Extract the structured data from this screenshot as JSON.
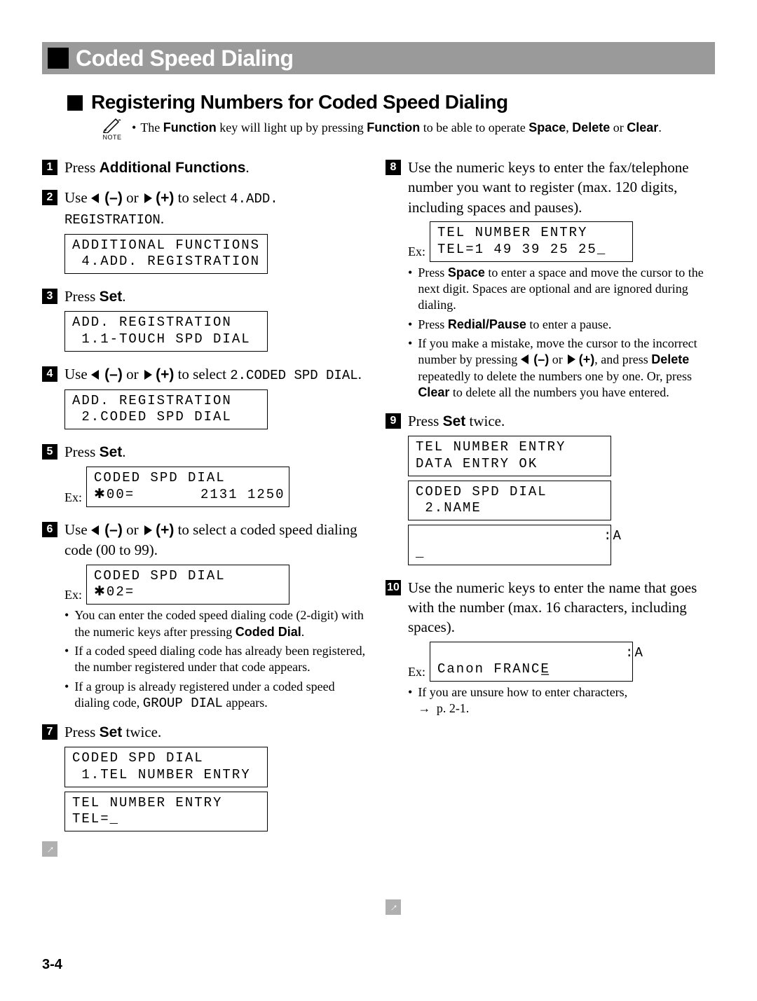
{
  "section_title": "Coded Speed Dialing",
  "sub_title": "Registering Numbers for Coded Speed Dialing",
  "note_label": "NOTE",
  "note_parts": {
    "p1": "The ",
    "k1": "Function",
    "p2": " key will light up by pressing ",
    "k2": "Function",
    "p3": " to be able to operate ",
    "k3": "Space",
    "p4": ", ",
    "k4": "Delete",
    "p5": " or ",
    "k5": "Clear",
    "p6": "."
  },
  "left": {
    "s1": {
      "num": "1",
      "p1": "Press ",
      "k1": "Additional Functions",
      "p2": "."
    },
    "s2": {
      "num": "2",
      "p1": "Use ",
      "nav_minus": "(–)",
      "p2": " or ",
      "nav_plus": "(+)",
      "p3": " to select ",
      "mono": "4.ADD. REGISTRATION",
      "p4": ".",
      "lcd": "ADDITIONAL FUNCTIONS\n 4.ADD. REGISTRATION"
    },
    "s3": {
      "num": "3",
      "p1": "Press ",
      "k1": "Set",
      "p2": ".",
      "lcd": "ADD. REGISTRATION\n 1.1-TOUCH SPD DIAL"
    },
    "s4": {
      "num": "4",
      "p1": "Use ",
      "nav_minus": "(–)",
      "p2": " or ",
      "nav_plus": "(+)",
      "p3": " to select ",
      "mono": "2.CODED SPD DIAL",
      "p4": ".",
      "lcd": "ADD. REGISTRATION\n 2.CODED SPD DIAL"
    },
    "s5": {
      "num": "5",
      "p1": "Press ",
      "k1": "Set",
      "p2": ".",
      "ex": "Ex:",
      "lcd": "CODED SPD DIAL\n✱00=       2131 1250"
    },
    "s6": {
      "num": "6",
      "p1": "Use ",
      "nav_minus": "(–)",
      "p2": " or ",
      "nav_plus": "(+)",
      "p3": " to select a coded speed dialing code (00 to 99).",
      "ex": "Ex:",
      "lcd": "CODED SPD DIAL\n✱02=",
      "b1p1": "You can enter the coded speed dialing code (2-digit) with the numeric keys after pressing ",
      "b1k1": "Coded Dial",
      "b1p2": ".",
      "b2": "If a coded speed dialing code has already been registered, the number registered under that code appears.",
      "b3p1": "If a group is already registered under a coded speed dialing code, ",
      "b3mono": "GROUP DIAL",
      "b3p2": " appears."
    },
    "s7": {
      "num": "7",
      "p1": "Press ",
      "k1": "Set",
      "p2": " twice.",
      "lcd1": "CODED SPD DIAL\n 1.TEL NUMBER ENTRY",
      "lcd2": "TEL NUMBER ENTRY\nTEL=_"
    }
  },
  "right": {
    "s8": {
      "num": "8",
      "text": "Use the numeric keys to enter the fax/telephone number you want to register (max. 120 digits, including spaces and pauses).",
      "ex": "Ex:",
      "lcd": "TEL NUMBER ENTRY\nTEL=1 49 39 25 25_",
      "b1p1": "Press ",
      "b1k1": "Space",
      "b1p2": " to enter a space and move the cursor to the next digit. Spaces are optional and are ignored during dialing.",
      "b2p1": "Press ",
      "b2k1": "Redial/Pause",
      "b2p2": " to enter a pause.",
      "b3p1": "If you make a mistake, move the cursor to the incorrect number by pressing ",
      "nav_minus": "(–)",
      "b3p2": " or ",
      "nav_plus": "(+)",
      "b3p3": ", and press ",
      "b3k1": "Delete",
      "b3p4": " repeatedly to delete the numbers one by one. Or, press ",
      "b3k2": "Clear",
      "b3p5": " to delete all the numbers you have entered."
    },
    "s9": {
      "num": "9",
      "p1": "Press ",
      "k1": "Set",
      "p2": " twice.",
      "lcd1": "TEL NUMBER ENTRY\nDATA ENTRY OK",
      "lcd2": "CODED SPD DIAL\n 2.NAME",
      "lcd3": "                    :A\n_"
    },
    "s10": {
      "num": "10",
      "text": "Use the numeric keys to enter the name that goes with the number (max. 16 characters, including spaces).",
      "ex": "Ex:",
      "lcd": "                    :A\nCanon FRANCE̲",
      "b1p1": "If you are unsure how to enter characters, ",
      "b1p2": " p. 2-1."
    }
  },
  "page_number": "3-4"
}
